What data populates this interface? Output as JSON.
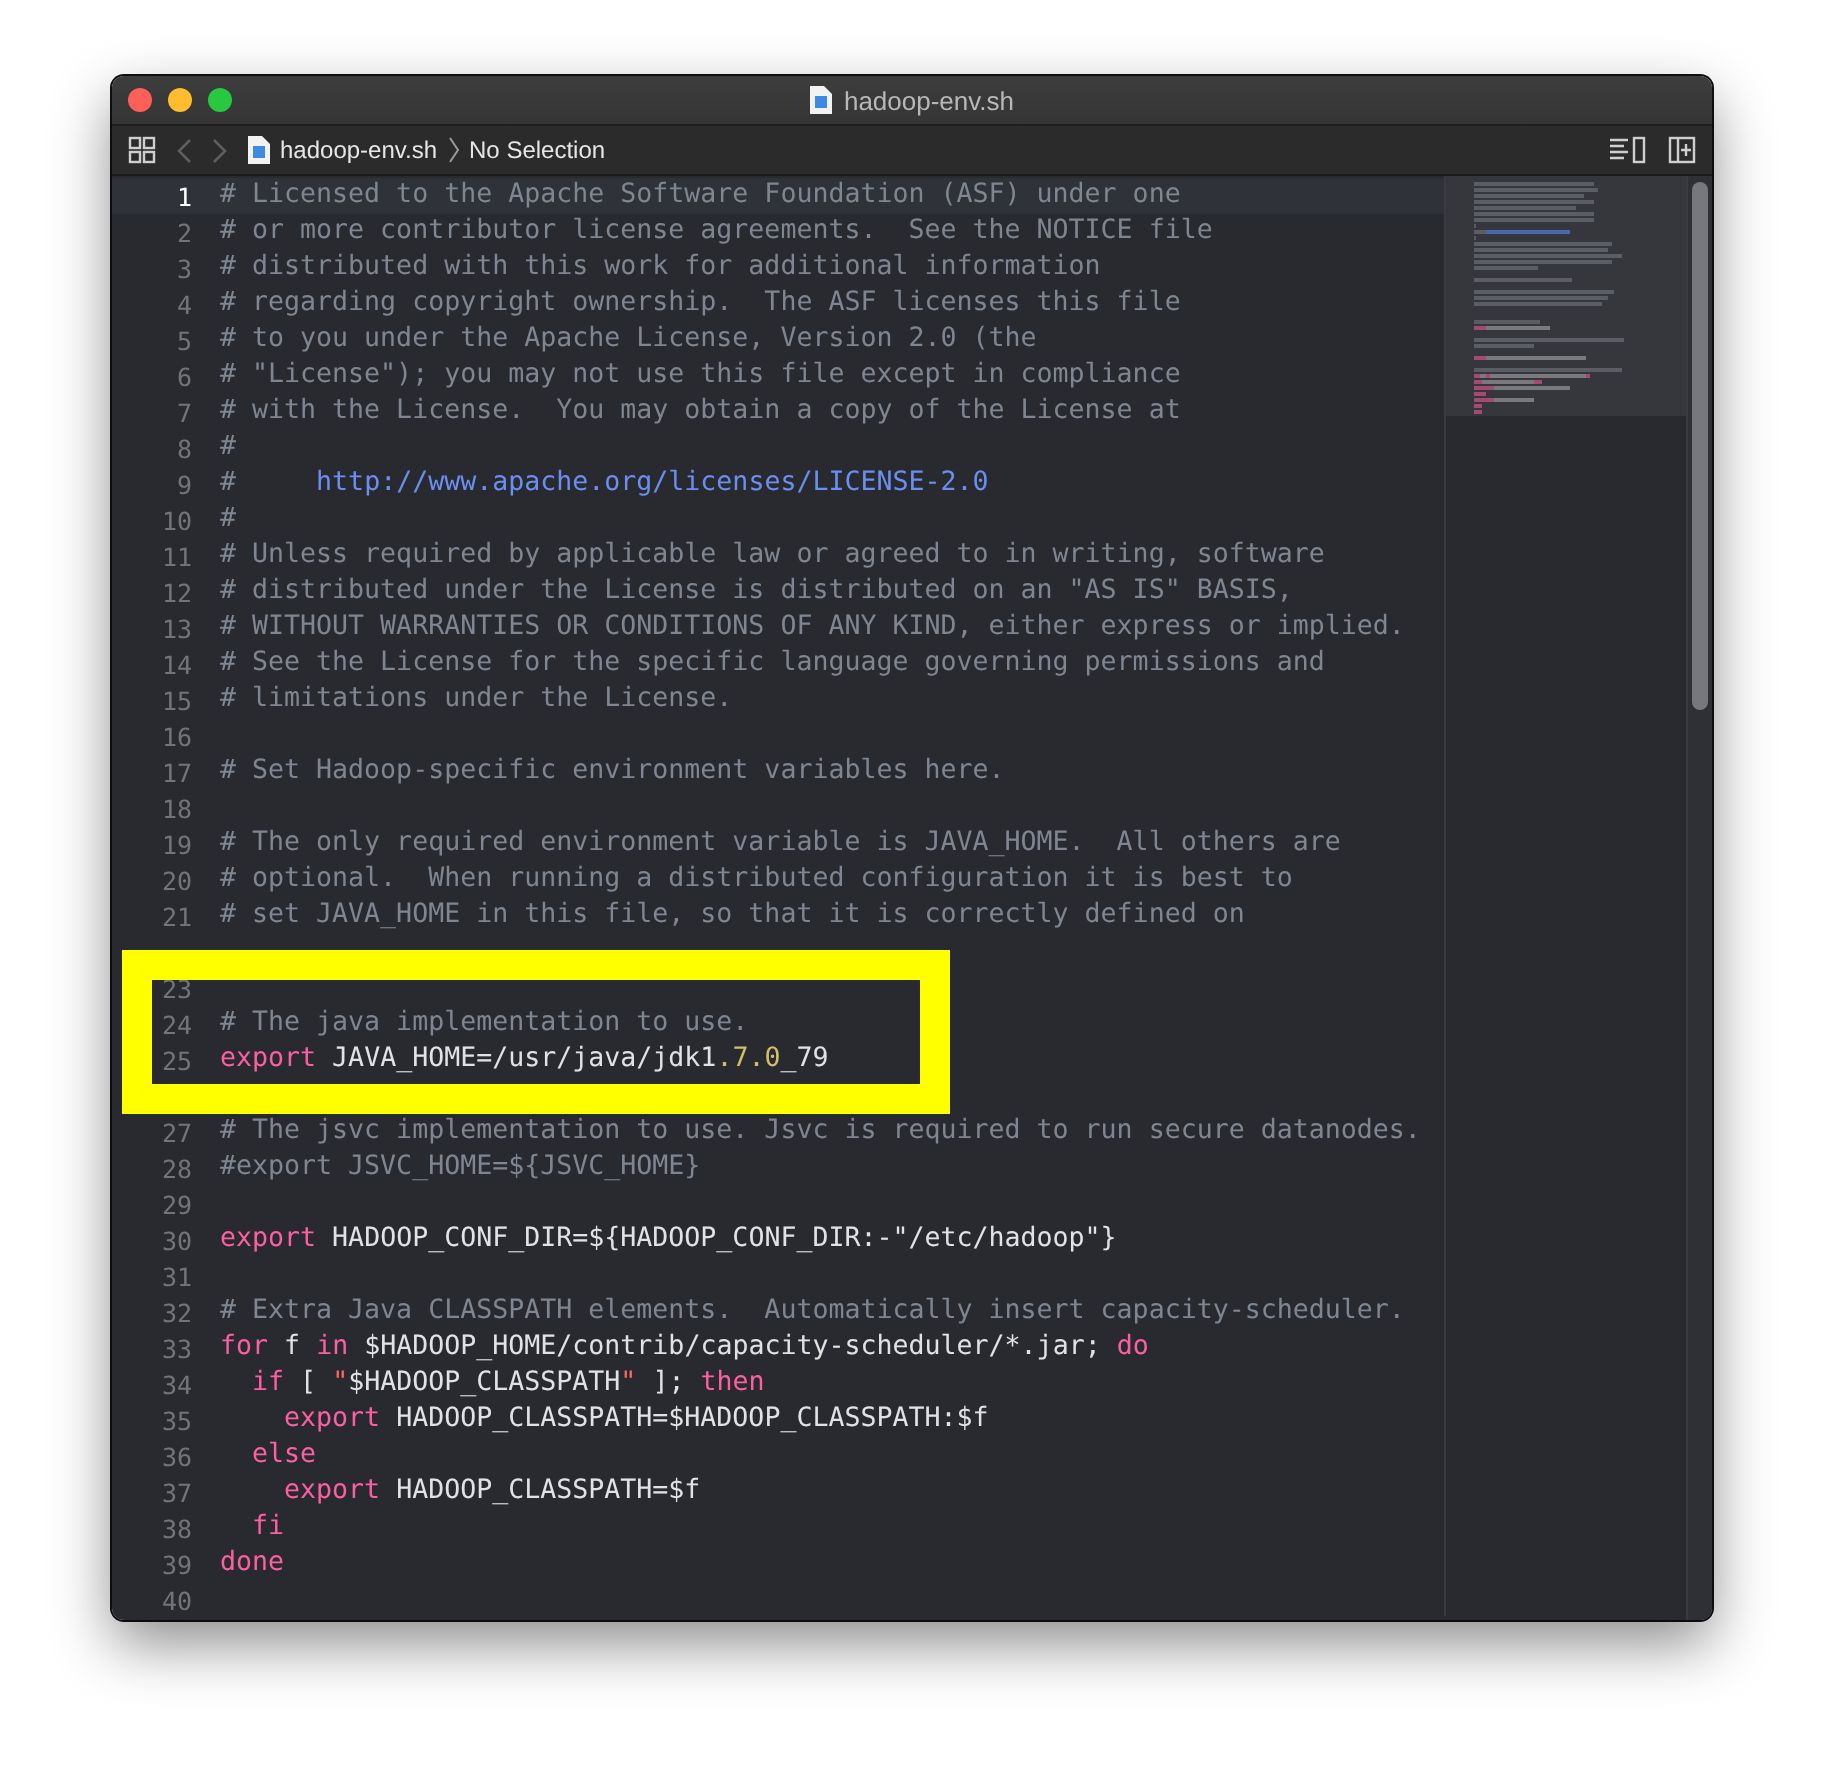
{
  "window": {
    "title": "hadoop-env.sh"
  },
  "jump_bar": {
    "file": "hadoop-env.sh",
    "selection": "No Selection"
  },
  "editor": {
    "lines": [
      {
        "number": "1",
        "current": true,
        "tokens": [
          {
            "kind": "comment",
            "text": "# Licensed to the Apache Software Foundation (ASF) under one"
          }
        ]
      },
      {
        "number": "2",
        "current": false,
        "tokens": [
          {
            "kind": "comment",
            "text": "# or more contributor license agreements.  See the NOTICE file"
          }
        ]
      },
      {
        "number": "3",
        "current": false,
        "tokens": [
          {
            "kind": "comment",
            "text": "# distributed with this work for additional information"
          }
        ]
      },
      {
        "number": "4",
        "current": false,
        "tokens": [
          {
            "kind": "comment",
            "text": "# regarding copyright ownership.  The ASF licenses this file"
          }
        ]
      },
      {
        "number": "5",
        "current": false,
        "tokens": [
          {
            "kind": "comment",
            "text": "# to you under the Apache License, Version 2.0 (the"
          }
        ]
      },
      {
        "number": "6",
        "current": false,
        "tokens": [
          {
            "kind": "comment",
            "text": "# \"License\"); you may not use this file except in compliance"
          }
        ]
      },
      {
        "number": "7",
        "current": false,
        "tokens": [
          {
            "kind": "comment",
            "text": "# with the License.  You may obtain a copy of the License at"
          }
        ]
      },
      {
        "number": "8",
        "current": false,
        "tokens": [
          {
            "kind": "comment",
            "text": "#"
          }
        ]
      },
      {
        "number": "9",
        "current": false,
        "tokens": [
          {
            "kind": "comment",
            "text": "#     "
          },
          {
            "kind": "url",
            "text": "http://www.apache.org/licenses/LICENSE-2.0"
          }
        ]
      },
      {
        "number": "10",
        "current": false,
        "tokens": [
          {
            "kind": "comment",
            "text": "#"
          }
        ]
      },
      {
        "number": "11",
        "current": false,
        "tokens": [
          {
            "kind": "comment",
            "text": "# Unless required by applicable law or agreed to in writing, software"
          }
        ]
      },
      {
        "number": "12",
        "current": false,
        "tokens": [
          {
            "kind": "comment",
            "text": "# distributed under the License is distributed on an \"AS IS\" BASIS,"
          }
        ]
      },
      {
        "number": "13",
        "current": false,
        "tokens": [
          {
            "kind": "comment",
            "text": "# WITHOUT WARRANTIES OR CONDITIONS OF ANY KIND, either express or implied."
          }
        ]
      },
      {
        "number": "14",
        "current": false,
        "tokens": [
          {
            "kind": "comment",
            "text": "# See the License for the specific language governing permissions and"
          }
        ]
      },
      {
        "number": "15",
        "current": false,
        "tokens": [
          {
            "kind": "comment",
            "text": "# limitations under the License."
          }
        ]
      },
      {
        "number": "16",
        "current": false
      },
      {
        "number": "17",
        "current": false,
        "tokens": [
          {
            "kind": "comment",
            "text": "# Set Hadoop-specific environment variables here."
          }
        ]
      },
      {
        "number": "18",
        "current": false
      },
      {
        "number": "19",
        "current": false,
        "tokens": [
          {
            "kind": "comment",
            "text": "# The only required environment variable is JAVA_HOME.  All others are"
          }
        ]
      },
      {
        "number": "20",
        "current": false,
        "tokens": [
          {
            "kind": "comment",
            "text": "# optional.  When running a distributed configuration it is best to"
          }
        ]
      },
      {
        "number": "21",
        "current": false,
        "tokens": [
          {
            "kind": "comment",
            "text": "# set JAVA_HOME in this file, so that it is correctly defined on"
          }
        ]
      },
      {
        "kind": "hidden"
      },
      {
        "number": "23",
        "current": false
      },
      {
        "number": "24",
        "current": false,
        "tokens": [
          {
            "kind": "comment",
            "text": "# The java implementation to use."
          }
        ]
      },
      {
        "number": "25",
        "current": false,
        "tokens": [
          {
            "kind": "keyword",
            "text": "export"
          },
          {
            "kind": "plain",
            "text": " JAVA_HOME=/usr/java/jdk1"
          },
          {
            "kind": "number",
            "text": ".7.0"
          },
          {
            "kind": "plain",
            "text": "_79"
          }
        ]
      },
      {
        "kind": "hidden"
      },
      {
        "number": "27",
        "current": false,
        "tokens": [
          {
            "kind": "comment",
            "text": "# The jsvc implementation to use. Jsvc is required to run secure datanodes."
          }
        ]
      },
      {
        "number": "28",
        "current": false,
        "tokens": [
          {
            "kind": "comment",
            "text": "#export JSVC_HOME=${JSVC_HOME}"
          }
        ]
      },
      {
        "number": "29",
        "current": false
      },
      {
        "number": "30",
        "current": false,
        "tokens": [
          {
            "kind": "keyword",
            "text": "export"
          },
          {
            "kind": "plain",
            "text": " HADOOP_CONF_DIR=${HADOOP_CONF_DIR:-\"/etc/hadoop\"}"
          }
        ]
      },
      {
        "number": "31",
        "current": false
      },
      {
        "number": "32",
        "current": false,
        "tokens": [
          {
            "kind": "comment",
            "text": "# Extra Java CLASSPATH elements.  Automatically insert capacity-scheduler."
          }
        ]
      },
      {
        "number": "33",
        "current": false,
        "tokens": [
          {
            "kind": "keyword",
            "text": "for"
          },
          {
            "kind": "plain",
            "text": " f "
          },
          {
            "kind": "keyword",
            "text": "in"
          },
          {
            "kind": "plain",
            "text": " $HADOOP_HOME/contrib/capacity-scheduler/*.jar; "
          },
          {
            "kind": "keyword",
            "text": "do"
          }
        ]
      },
      {
        "number": "34",
        "current": false,
        "tokens": [
          {
            "kind": "keyword",
            "text": "  if"
          },
          {
            "kind": "plain",
            "text": " [ "
          },
          {
            "kind": "string",
            "text": "\""
          },
          {
            "kind": "plain",
            "text": "$HADOOP_CLASSPATH"
          },
          {
            "kind": "string",
            "text": "\""
          },
          {
            "kind": "plain",
            "text": " ]; "
          },
          {
            "kind": "keyword",
            "text": "then"
          }
        ]
      },
      {
        "number": "35",
        "current": false,
        "tokens": [
          {
            "kind": "keyword",
            "text": "    export"
          },
          {
            "kind": "plain",
            "text": " HADOOP_CLASSPATH=$HADOOP_CLASSPATH:$f"
          }
        ]
      },
      {
        "number": "36",
        "current": false,
        "tokens": [
          {
            "kind": "keyword",
            "text": "  else"
          }
        ]
      },
      {
        "number": "37",
        "current": false,
        "tokens": [
          {
            "kind": "keyword",
            "text": "    export"
          },
          {
            "kind": "plain",
            "text": " HADOOP_CLASSPATH=$f"
          }
        ]
      },
      {
        "number": "38",
        "current": false,
        "tokens": [
          {
            "kind": "keyword",
            "text": "  fi"
          }
        ]
      },
      {
        "number": "39",
        "current": false,
        "tokens": [
          {
            "kind": "keyword",
            "text": "done"
          }
        ]
      },
      {
        "number": "40",
        "current": false
      }
    ]
  }
}
